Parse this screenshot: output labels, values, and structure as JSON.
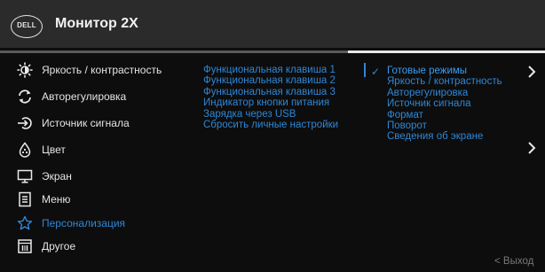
{
  "header": {
    "logo_text": "DELL",
    "title": "Монитор 2X"
  },
  "menu": {
    "items": [
      {
        "label": "Яркость / контрастность",
        "icon": "brightness-icon"
      },
      {
        "label": "Авторегулировка",
        "icon": "auto-adjust-icon"
      },
      {
        "label": "Источник сигнала",
        "icon": "input-source-icon"
      },
      {
        "label": "Цвет",
        "icon": "color-icon"
      },
      {
        "label": "Экран",
        "icon": "display-icon"
      },
      {
        "label": "Меню",
        "icon": "menu-icon"
      },
      {
        "label": "Персонализация",
        "icon": "star-icon",
        "active": true
      },
      {
        "label": "Другое",
        "icon": "others-icon"
      }
    ]
  },
  "shortcut_keys": [
    "Функциональная клавиша 1",
    "Функциональная клавиша 2",
    "Функциональная клавиша 3",
    "Индикатор кнопки питания",
    "Зарядка через USB",
    "Сбросить личные настройки"
  ],
  "options": [
    "Готовые режимы",
    "Яркость / контрастность",
    "Авторегулировка",
    "Источник сигнала",
    "Формат",
    "Поворот",
    "Сведения об экране"
  ],
  "symbols": {
    "arrow_right": "›",
    "check": "✓"
  },
  "footer": {
    "exit_label": "< Выход"
  },
  "colors": {
    "accent": "#2f86d6",
    "header_bg": "#2b2b2b",
    "background": "#0d0d0d",
    "text": "#e4e4e4",
    "muted": "#7a7a7a"
  }
}
